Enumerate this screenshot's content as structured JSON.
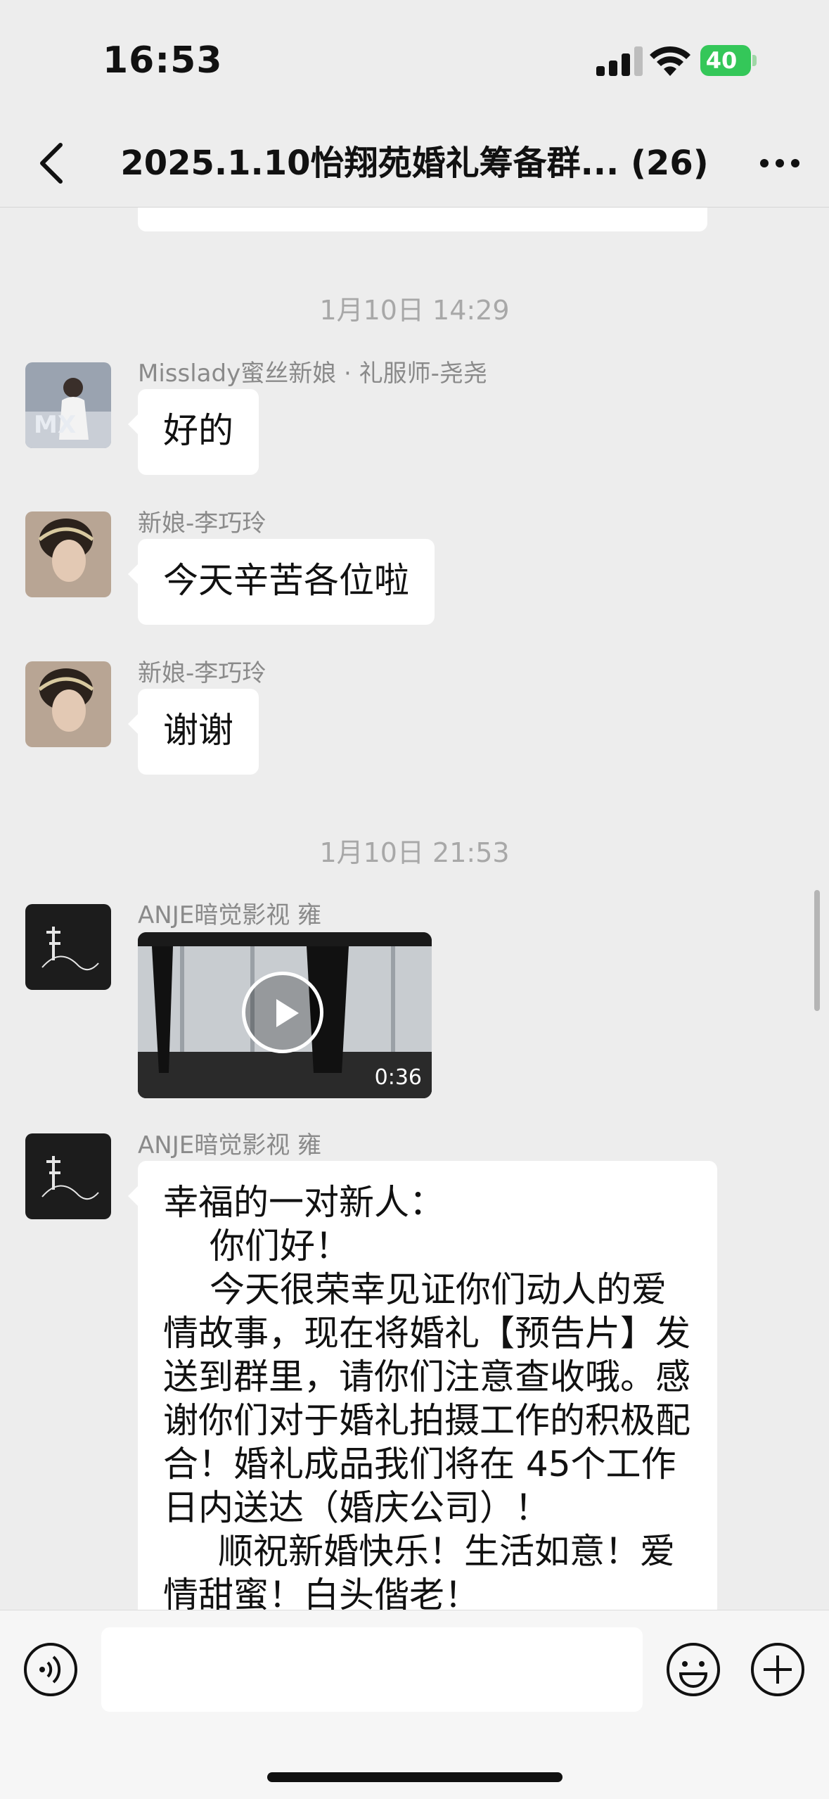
{
  "status_bar": {
    "time": "16:53",
    "battery": "40"
  },
  "nav": {
    "title": "2025.1.10怡翔苑婚礼筹备群... (26)"
  },
  "chat": {
    "timestamps": [
      "1月10日 14:29",
      "1月10日 21:53"
    ],
    "messages": [
      {
        "sender": "Misslady蜜丝新娘 · 礼服师-尧尧",
        "text": "好的"
      },
      {
        "sender": "新娘-李巧玲",
        "text": "今天辛苦各位啦"
      },
      {
        "sender": "新娘-李巧玲",
        "text": "谢谢"
      },
      {
        "sender": "ANJE暗觉影视 雍",
        "video_duration": "0:36"
      },
      {
        "sender": "ANJE暗觉影视 雍",
        "lines": [
          "幸福的一对新人：",
          "你们好！",
          "今天很荣幸见证你们动人的爱情故事，现在将婚礼【预告片】发送到群里，请你们注意查收哦。感谢你们对于婚礼拍摄工作的积极配合！婚礼成品我们将在 45个工作日内送达（婚庆公司）！",
          "顺祝新婚快乐！生活如意！爱情甜蜜！白头偕老！"
        ]
      }
    ]
  },
  "input": {
    "value": ""
  },
  "colors": {
    "background": "#ededed",
    "bubble": "#ffffff",
    "battery": "#34c759"
  }
}
